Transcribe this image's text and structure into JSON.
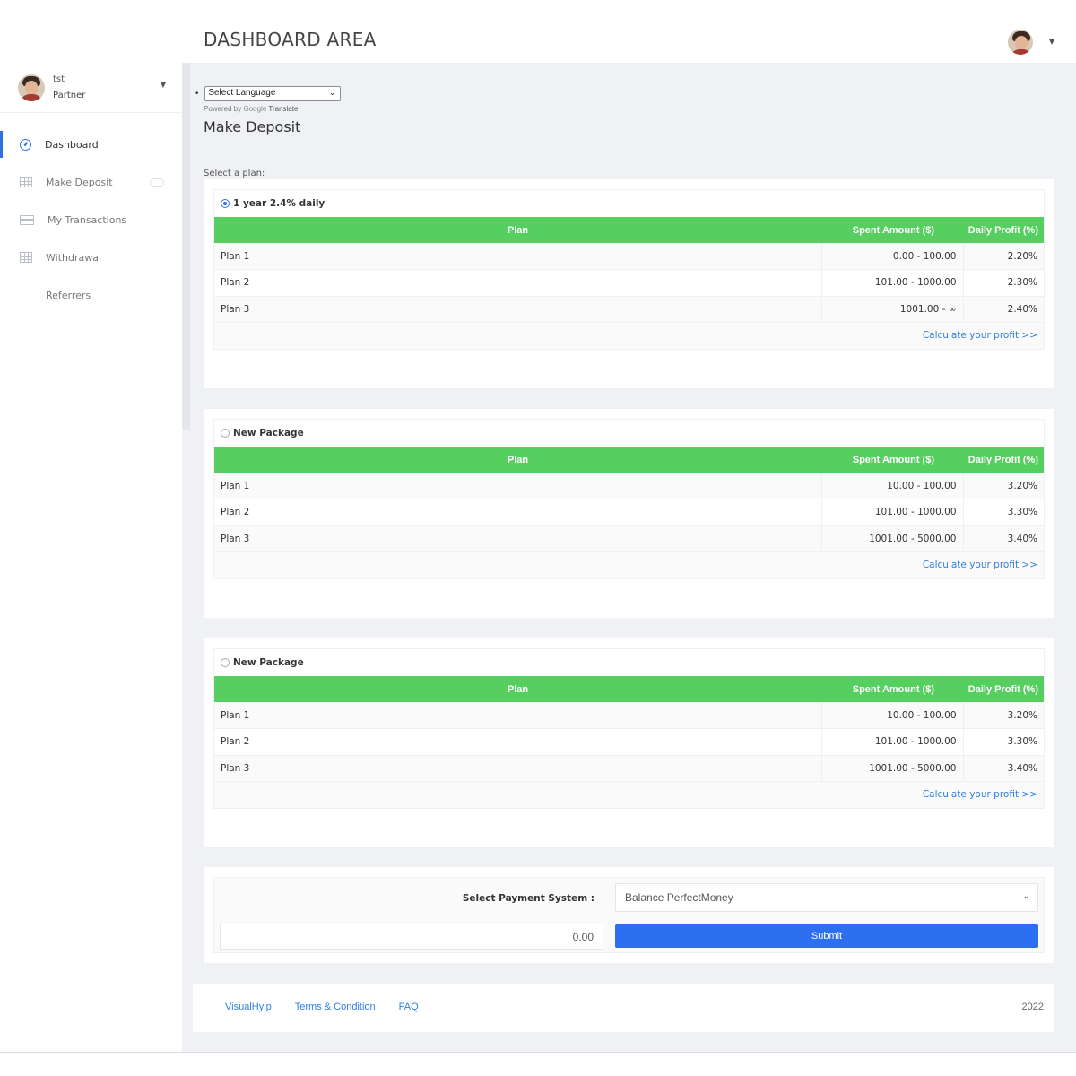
{
  "header": {
    "title": "DASHBOARD AREA"
  },
  "user": {
    "name": "tst",
    "role": "Partner"
  },
  "sidebar": {
    "items": [
      {
        "label": "Dashboard",
        "icon": "dashboard-gauge-icon",
        "active": true
      },
      {
        "label": "Make Deposit",
        "icon": "grid-icon"
      },
      {
        "label": "My Transactions",
        "icon": "card-icon"
      },
      {
        "label": "Withdrawal",
        "icon": "grid-icon"
      },
      {
        "label": "Referrers",
        "icon": ""
      }
    ]
  },
  "translate": {
    "select_label": "Select Language",
    "powered_by": "Powered by",
    "google": "Google",
    "translate": "Translate"
  },
  "page": {
    "heading": "Make Deposit",
    "select_plan_label": "Select a plan:"
  },
  "table_headers": {
    "plan": "Plan",
    "spent": "Spent Amount ($)",
    "profit": "Daily Profit (%)"
  },
  "packages": [
    {
      "name": "1 year 2.4% daily",
      "selected": true,
      "rows": [
        {
          "plan": "Plan 1",
          "spent": "0.00 - 100.00",
          "profit": "2.20%"
        },
        {
          "plan": "Plan 2",
          "spent": "101.00 - 1000.00",
          "profit": "2.30%"
        },
        {
          "plan": "Plan 3",
          "spent": "1001.00 - ∞",
          "profit": "2.40%"
        }
      ],
      "calc_link": "Calculate your profit >>"
    },
    {
      "name": "New Package",
      "selected": false,
      "rows": [
        {
          "plan": "Plan 1",
          "spent": "10.00 - 100.00",
          "profit": "3.20%"
        },
        {
          "plan": "Plan 2",
          "spent": "101.00 - 1000.00",
          "profit": "3.30%"
        },
        {
          "plan": "Plan 3",
          "spent": "1001.00 - 5000.00",
          "profit": "3.40%"
        }
      ],
      "calc_link": "Calculate your profit >>"
    },
    {
      "name": "New Package",
      "selected": false,
      "rows": [
        {
          "plan": "Plan 1",
          "spent": "10.00 - 100.00",
          "profit": "3.20%"
        },
        {
          "plan": "Plan 2",
          "spent": "101.00 - 1000.00",
          "profit": "3.30%"
        },
        {
          "plan": "Plan 3",
          "spent": "1001.00 - 5000.00",
          "profit": "3.40%"
        }
      ],
      "calc_link": "Calculate your profit >>"
    }
  ],
  "payment": {
    "label": "Select Payment System :",
    "selected": "Balance PerfectMoney",
    "amount": "0.00",
    "submit": "Submit"
  },
  "footer": {
    "links": [
      "VisualHyip",
      "Terms & Condition",
      "FAQ"
    ],
    "year": "2022"
  },
  "colors": {
    "accent": "#2e6ef0",
    "table_header": "#56cf60",
    "link": "#2f7fe4"
  }
}
